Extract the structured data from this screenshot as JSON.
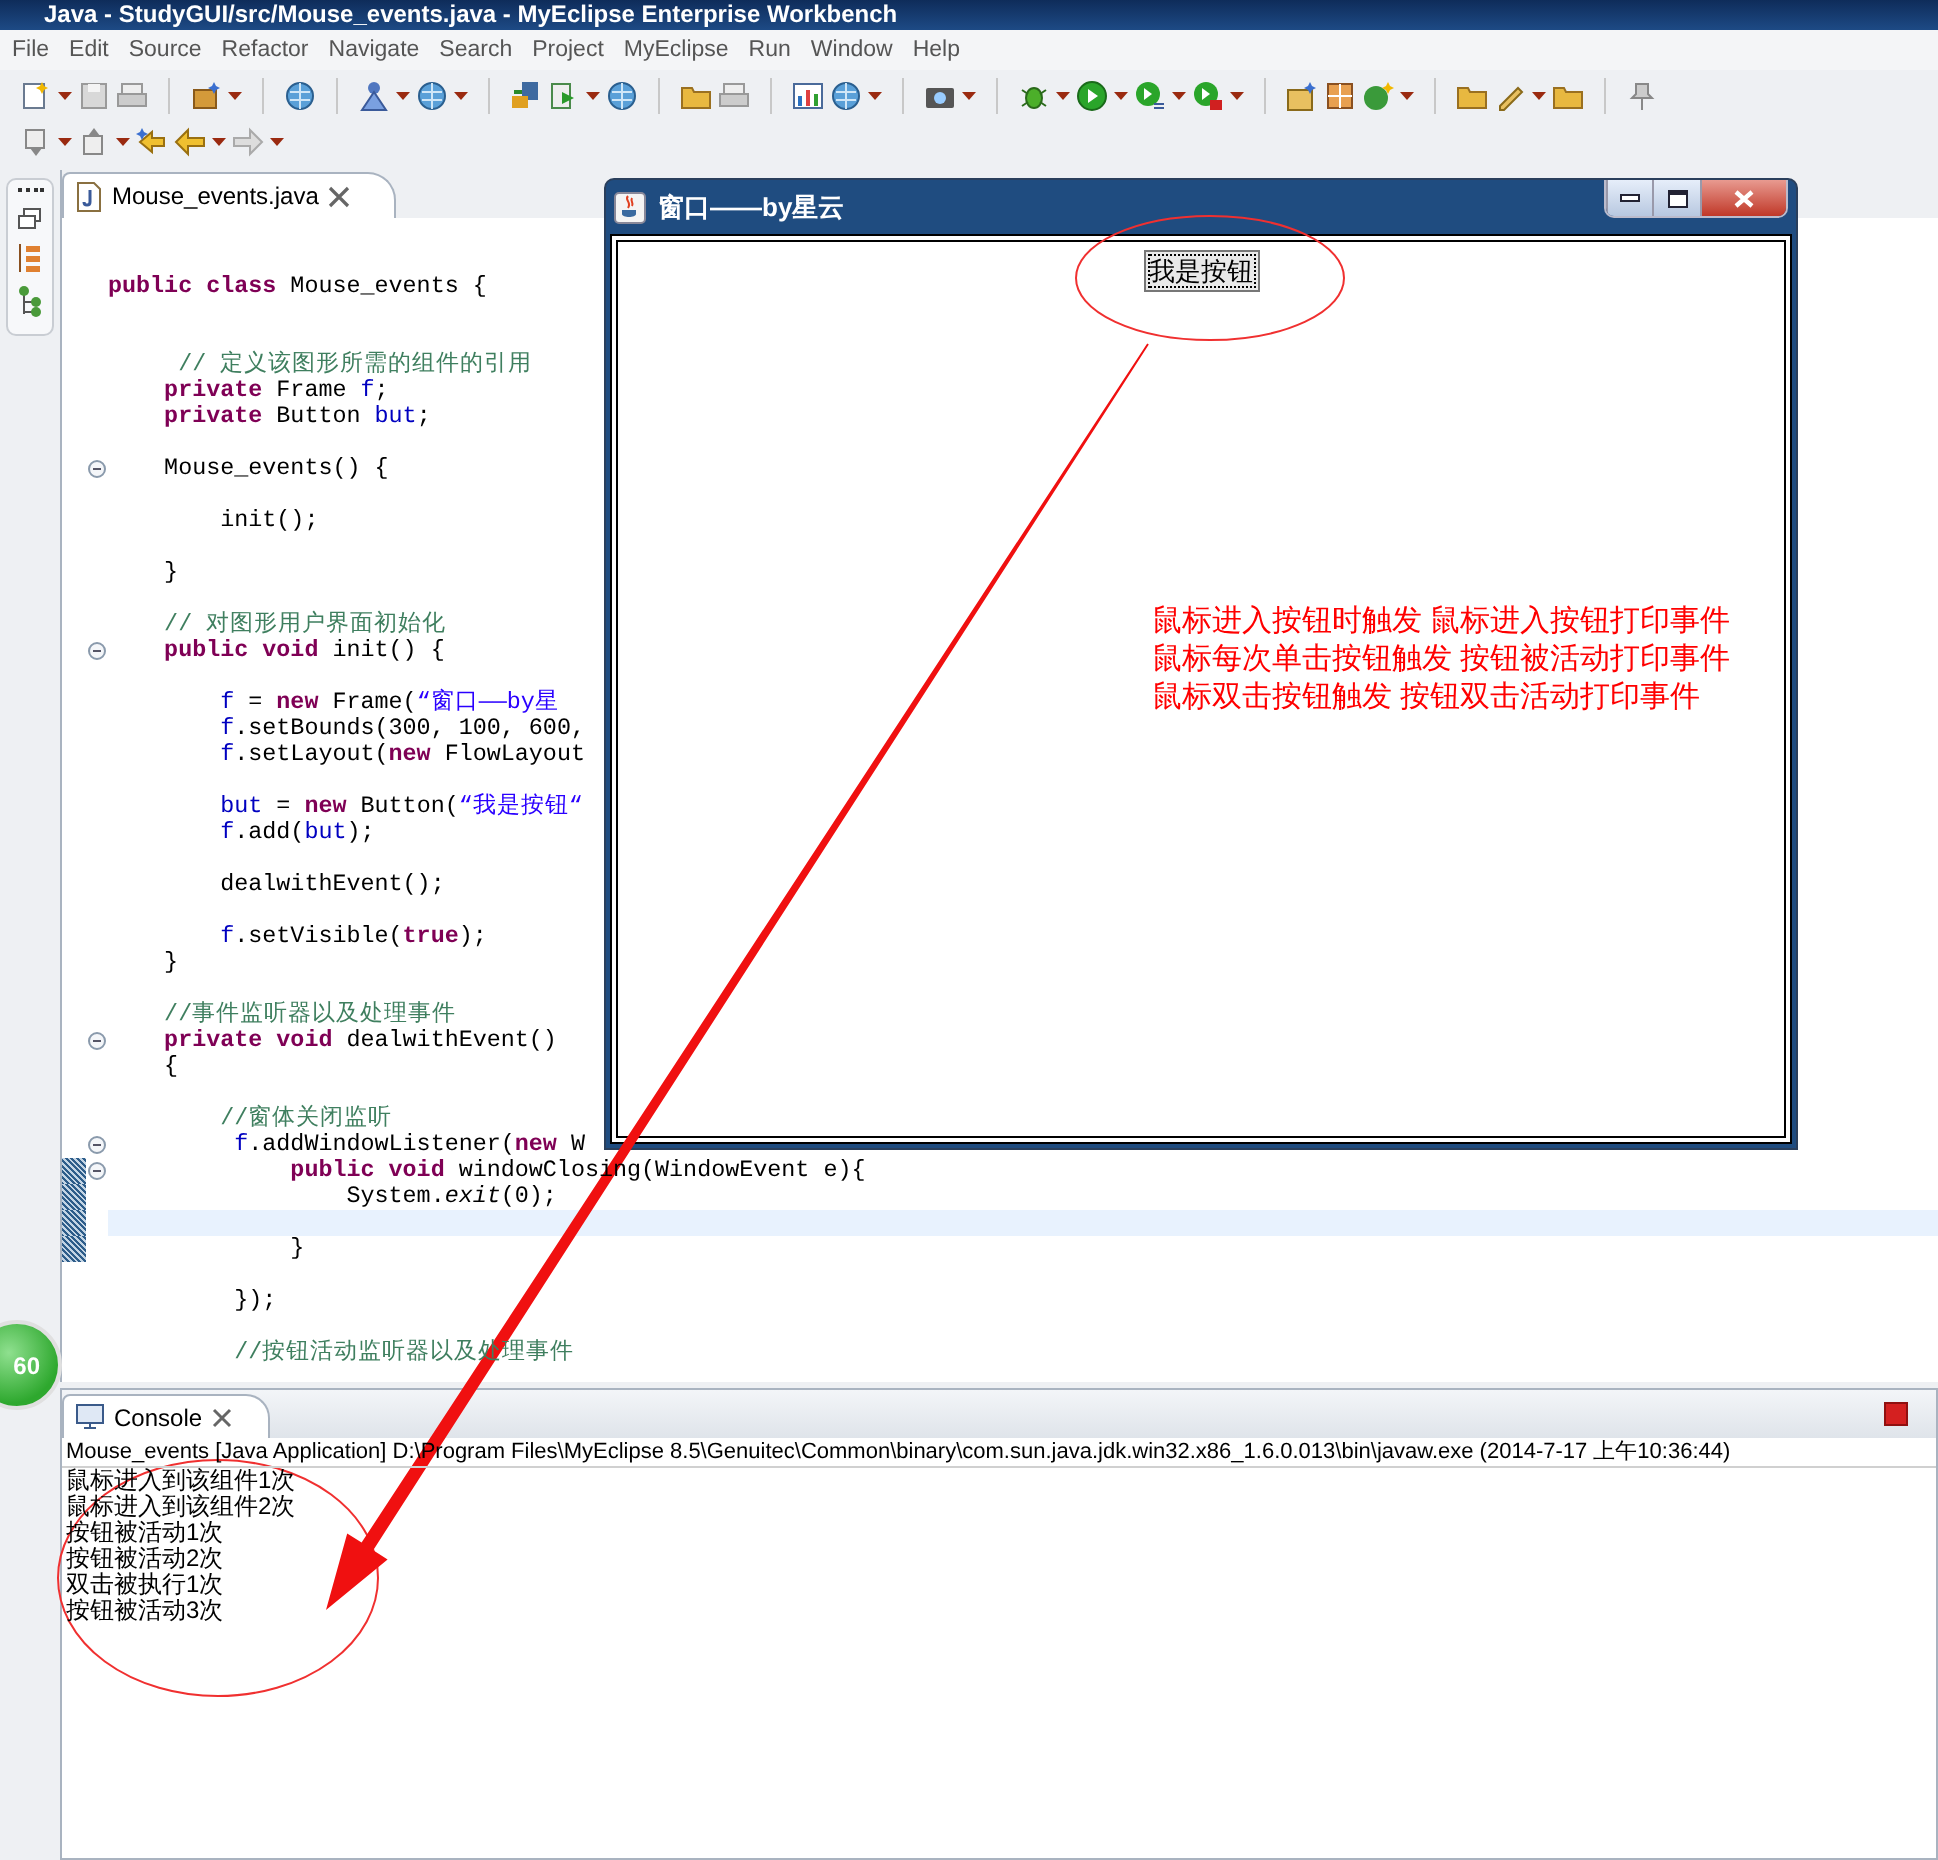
{
  "window": {
    "title": "Java - StudyGUI/src/Mouse_events.java - MyEclipse Enterprise Workbench"
  },
  "menu": [
    "File",
    "Edit",
    "Source",
    "Refactor",
    "Navigate",
    "Search",
    "Project",
    "MyEclipse",
    "Run",
    "Window",
    "Help"
  ],
  "editor": {
    "tab": {
      "label": "Mouse_events.java",
      "selected": true
    },
    "lines": [
      {
        "fold": false,
        "changed": false,
        "current": false
      },
      {
        "fold": false,
        "changed": false,
        "current": false
      },
      {
        "tokens": [
          {
            "kind": "keyword",
            "text": "public class"
          },
          {
            "kind": "plain",
            "text": " Mouse_events {"
          }
        ],
        "fold": false,
        "changed": false,
        "current": false
      },
      {
        "fold": false,
        "changed": false,
        "current": false
      },
      {
        "fold": false,
        "changed": false,
        "current": false
      },
      {
        "tokens": [
          {
            "kind": "comment",
            "text": "     // 定义该图形所需的组件的引用"
          }
        ],
        "fold": false,
        "changed": false,
        "current": false
      },
      {
        "tokens": [
          {
            "kind": "keyword",
            "text": "    private"
          },
          {
            "kind": "plain",
            "text": " Frame "
          },
          {
            "kind": "field",
            "text": "f"
          },
          {
            "kind": "plain",
            "text": ";"
          }
        ],
        "fold": false,
        "changed": false,
        "current": false
      },
      {
        "tokens": [
          {
            "kind": "keyword",
            "text": "    private"
          },
          {
            "kind": "plain",
            "text": " Button "
          },
          {
            "kind": "field",
            "text": "but"
          },
          {
            "kind": "plain",
            "text": ";"
          }
        ],
        "fold": false,
        "changed": false,
        "current": false
      },
      {
        "fold": false,
        "changed": false,
        "current": false
      },
      {
        "tokens": [
          {
            "kind": "plain",
            "text": "    Mouse_events() {"
          }
        ],
        "fold": true,
        "changed": false,
        "current": false
      },
      {
        "fold": false,
        "changed": false,
        "current": false
      },
      {
        "tokens": [
          {
            "kind": "plain",
            "text": "        init();"
          }
        ],
        "fold": false,
        "changed": false,
        "current": false
      },
      {
        "fold": false,
        "changed": false,
        "current": false
      },
      {
        "tokens": [
          {
            "kind": "plain",
            "text": "    }"
          }
        ],
        "fold": false,
        "changed": false,
        "current": false
      },
      {
        "fold": false,
        "changed": false,
        "current": false
      },
      {
        "tokens": [
          {
            "kind": "comment",
            "text": "    // 对图形用户界面初始化"
          }
        ],
        "fold": false,
        "changed": false,
        "current": false
      },
      {
        "tokens": [
          {
            "kind": "keyword",
            "text": "    public void"
          },
          {
            "kind": "plain",
            "text": " init() {"
          }
        ],
        "fold": true,
        "changed": false,
        "current": false
      },
      {
        "fold": false,
        "changed": false,
        "current": false
      },
      {
        "tokens": [
          {
            "kind": "field",
            "text": "        f"
          },
          {
            "kind": "plain",
            "text": " = "
          },
          {
            "kind": "keyword",
            "text": "new"
          },
          {
            "kind": "plain",
            "text": " Frame("
          },
          {
            "kind": "string",
            "text": "“窗口——by星"
          }
        ],
        "fold": false,
        "changed": false,
        "current": false
      },
      {
        "tokens": [
          {
            "kind": "field",
            "text": "        f"
          },
          {
            "kind": "plain",
            "text": ".setBounds(300, 100, 600,"
          }
        ],
        "fold": false,
        "changed": false,
        "current": false
      },
      {
        "tokens": [
          {
            "kind": "field",
            "text": "        f"
          },
          {
            "kind": "plain",
            "text": ".setLayout("
          },
          {
            "kind": "keyword",
            "text": "new"
          },
          {
            "kind": "plain",
            "text": " FlowLayout"
          }
        ],
        "fold": false,
        "changed": false,
        "current": false
      },
      {
        "fold": false,
        "changed": false,
        "current": false
      },
      {
        "tokens": [
          {
            "kind": "field",
            "text": "        but"
          },
          {
            "kind": "plain",
            "text": " = "
          },
          {
            "kind": "keyword",
            "text": "new"
          },
          {
            "kind": "plain",
            "text": " Button("
          },
          {
            "kind": "string",
            "text": "“我是按钮“"
          }
        ],
        "fold": false,
        "changed": false,
        "current": false
      },
      {
        "tokens": [
          {
            "kind": "field",
            "text": "        f"
          },
          {
            "kind": "plain",
            "text": ".add("
          },
          {
            "kind": "field",
            "text": "but"
          },
          {
            "kind": "plain",
            "text": ");"
          }
        ],
        "fold": false,
        "changed": false,
        "current": false
      },
      {
        "fold": false,
        "changed": false,
        "current": false
      },
      {
        "tokens": [
          {
            "kind": "plain",
            "text": "        dealwithEvent();"
          }
        ],
        "fold": false,
        "changed": false,
        "current": false
      },
      {
        "fold": false,
        "changed": false,
        "current": false
      },
      {
        "tokens": [
          {
            "kind": "field",
            "text": "        f"
          },
          {
            "kind": "plain",
            "text": ".setVisible("
          },
          {
            "kind": "keyword",
            "text": "true"
          },
          {
            "kind": "plain",
            "text": ");"
          }
        ],
        "fold": false,
        "changed": false,
        "current": false
      },
      {
        "tokens": [
          {
            "kind": "plain",
            "text": "    }"
          }
        ],
        "fold": false,
        "changed": false,
        "current": false
      },
      {
        "fold": false,
        "changed": false,
        "current": false
      },
      {
        "tokens": [
          {
            "kind": "comment",
            "text": "    //事件监听器以及处理事件"
          }
        ],
        "fold": false,
        "changed": false,
        "current": false
      },
      {
        "tokens": [
          {
            "kind": "keyword",
            "text": "    private void"
          },
          {
            "kind": "plain",
            "text": " dealwithEvent()"
          }
        ],
        "fold": true,
        "changed": false,
        "current": false
      },
      {
        "tokens": [
          {
            "kind": "plain",
            "text": "    {"
          }
        ],
        "fold": false,
        "changed": false,
        "current": false
      },
      {
        "fold": false,
        "changed": false,
        "current": false
      },
      {
        "tokens": [
          {
            "kind": "comment",
            "text": "        //窗体关闭监听"
          }
        ],
        "fold": false,
        "changed": false,
        "current": false
      },
      {
        "tokens": [
          {
            "kind": "field",
            "text": "         f"
          },
          {
            "kind": "plain",
            "text": ".addWindowListener("
          },
          {
            "kind": "keyword",
            "text": "new"
          },
          {
            "kind": "plain",
            "text": " W"
          }
        ],
        "fold": true,
        "changed": false,
        "current": false
      },
      {
        "tokens": [
          {
            "kind": "keyword",
            "text": "             public void"
          },
          {
            "kind": "plain",
            "text": " windowClosing(WindowEvent e){"
          }
        ],
        "fold": true,
        "changed": true,
        "current": false
      },
      {
        "tokens": [
          {
            "kind": "plain",
            "text": "                 System."
          },
          {
            "kind": "static",
            "text": "exit"
          },
          {
            "kind": "plain",
            "text": "(0);"
          }
        ],
        "fold": false,
        "changed": true,
        "current": false
      },
      {
        "fold": false,
        "changed": true,
        "current": true
      },
      {
        "tokens": [
          {
            "kind": "plain",
            "text": "             }"
          }
        ],
        "fold": false,
        "changed": true,
        "current": false
      },
      {
        "fold": false,
        "changed": false,
        "current": false
      },
      {
        "tokens": [
          {
            "kind": "plain",
            "text": "         });"
          }
        ],
        "fold": false,
        "changed": false,
        "current": false
      },
      {
        "fold": false,
        "changed": false,
        "current": false
      },
      {
        "tokens": [
          {
            "kind": "comment",
            "text": "         //按钮活动监听器以及处理事件"
          }
        ],
        "fold": false,
        "changed": false,
        "current": false
      }
    ]
  },
  "java_frame": {
    "title": "窗口——by星云",
    "button": "我是按钮",
    "notes": [
      "鼠标进入按钮时触发 鼠标进入按钮打印事件",
      "鼠标每次单击按钮触发 按钮被活动打印事件",
      "鼠标双击按钮触发 按钮双击活动打印事件"
    ]
  },
  "badge": "60",
  "console": {
    "tab": {
      "label": "Console",
      "selected": true
    },
    "header": "Mouse_events [Java Application] D:\\Program Files\\MyEclipse 8.5\\Genuitec\\Common\\binary\\com.sun.java.jdk.win32.x86_1.6.0.013\\bin\\javaw.exe (2014-7-17 上午10:36:44)",
    "output": [
      "鼠标进入到该组件1次",
      "鼠标进入到该组件2次",
      "按钮被活动1次",
      "按钮被活动2次",
      "双击被执行1次",
      "按钮被活动3次"
    ]
  }
}
